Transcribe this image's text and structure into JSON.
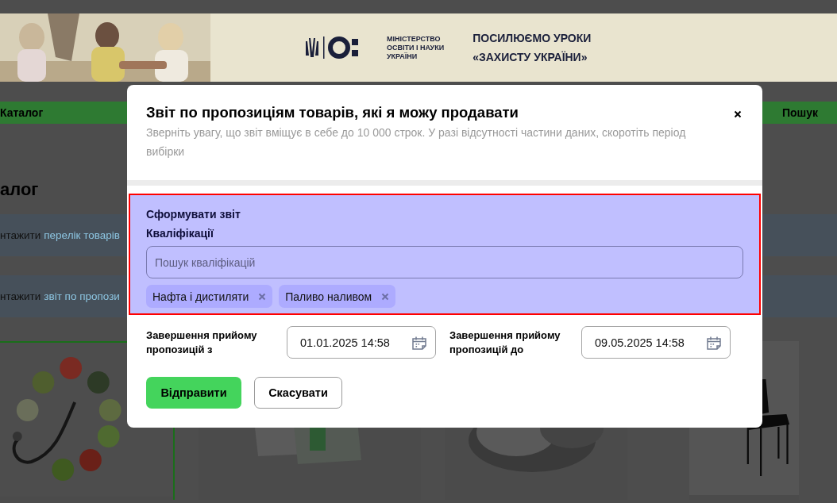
{
  "header": {
    "ministry_lines": [
      "МІНІСТЕРСТВО",
      "ОСВІТИ І НАУКИ",
      "УКРАЇНИ"
    ],
    "promo_lines": [
      "ПОСИЛЮЄМО УРОКИ",
      "«ЗАХИСТУ УКРАЇНИ»"
    ]
  },
  "nav": {
    "items": [
      {
        "label": "Каталог"
      },
      {
        "label": "Пошук"
      }
    ]
  },
  "page": {
    "title": "алог",
    "rows": [
      {
        "text": "нтажити",
        "link": "перелік товарів"
      },
      {
        "text": "нтажити",
        "link": "звіт по пропози"
      }
    ]
  },
  "modal": {
    "title": "Звіт по пропозиціям товарів, які я можу продавати",
    "subtitle": "Зверніть увагу, що звіт вміщує в себе до 10 000 строк. У разі відсутності частини даних, скоротіть період вибірки",
    "section": {
      "heading": "Сформувати звіт",
      "label": "Кваліфікації",
      "search": {
        "placeholder": "Пошук кваліфікацій"
      },
      "chips": [
        {
          "label": "Нафта і дистиляти"
        },
        {
          "label": "Паливо наливом"
        }
      ]
    },
    "date_fields": [
      {
        "label": "Завершення прийому пропозицій з",
        "value": "01.01.2025 14:58"
      },
      {
        "label": "Завершення прийому пропозицій до",
        "value": "09.05.2025 14:58"
      }
    ],
    "buttons": [
      {
        "label": "Відправити",
        "kind": "primary"
      },
      {
        "label": "Скасувати",
        "kind": "secondary"
      }
    ]
  }
}
